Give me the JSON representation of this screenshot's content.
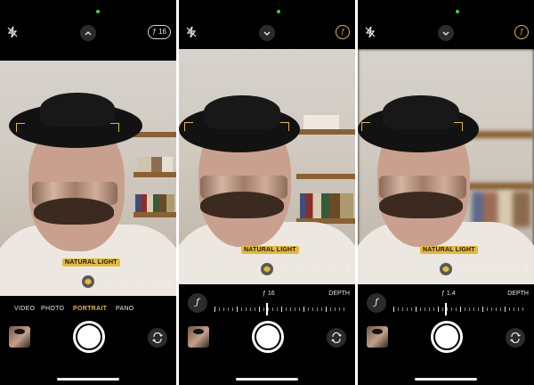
{
  "colors": {
    "accent": "#e2b93a",
    "status_dot": "#3ecf4a",
    "background": "#000000"
  },
  "panels": [
    {
      "aperture_badge": "ƒ 16",
      "lighting_label": "NATURAL LIGHT",
      "modes": [
        "VIDEO",
        "PHOTO",
        "PORTRAIT",
        "PANO"
      ],
      "active_mode": "PORTRAIT"
    },
    {
      "aperture_badge": "ƒ",
      "lighting_label": "NATURAL LIGHT",
      "f_button": "ƒ",
      "f_value": "ƒ 16",
      "depth_label": "DEPTH"
    },
    {
      "aperture_badge": "ƒ",
      "lighting_label": "NATURAL LIGHT",
      "f_button": "ƒ",
      "f_value": "ƒ 1.4",
      "depth_label": "DEPTH"
    }
  ],
  "icons": {
    "flash": "flash-off-icon",
    "chevron_p1": "chevron-up-icon",
    "chevron_p23": "chevron-down-icon",
    "lighting": "portrait-lighting-cube-icon",
    "flip": "camera-flip-icon"
  }
}
